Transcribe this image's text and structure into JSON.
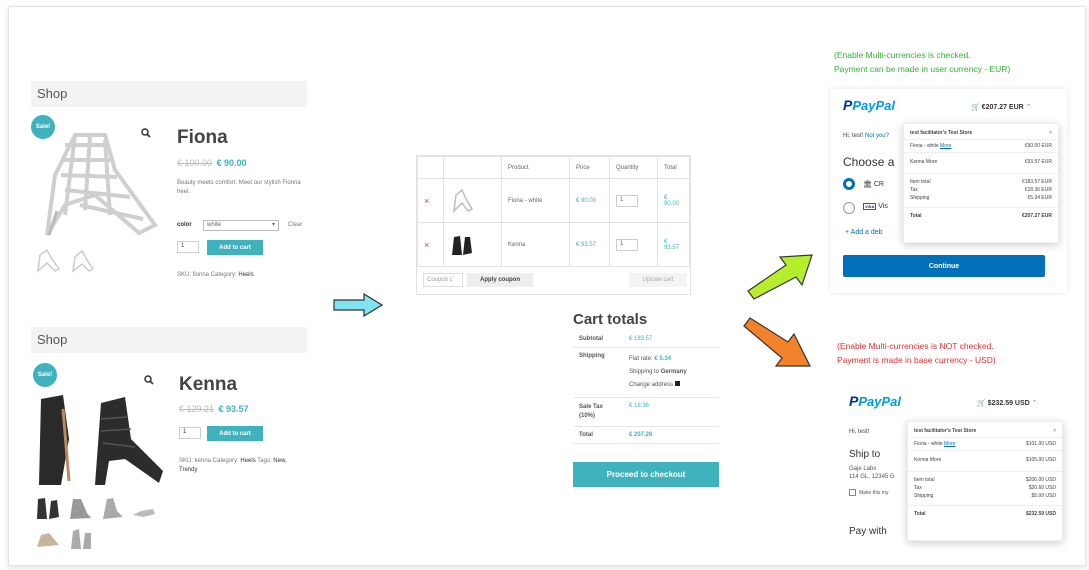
{
  "shop1": {
    "heading": "Shop",
    "sale_badge": "Sale!",
    "title": "Fiona",
    "old_price": "€ 100.00",
    "price": "€ 90.00",
    "description": "Beauty meets comfort. Meet our stylish Fionna heel.",
    "color_label": "color",
    "color_value": "white",
    "clear_label": "Clear",
    "qty": "1",
    "add_to_cart": "Add to cart",
    "sku_text": "SKU: fionna Category:",
    "category": "Heels"
  },
  "shop2": {
    "heading": "Shop",
    "sale_badge": "Sale!",
    "title": "Kenna",
    "old_price": "€ 129.21",
    "price": "€ 93.57",
    "qty": "1",
    "add_to_cart": "Add to cart",
    "sku_text": "SKU: kenna Category:",
    "category": "Heels",
    "tags_label": "Tags:",
    "tags": "New, Trendy"
  },
  "cart": {
    "headers": [
      "",
      "",
      "Product",
      "Price",
      "Quantity",
      "Total"
    ],
    "rows": [
      {
        "remove": "×",
        "product": "Fiona - white",
        "price": "€ 90.00",
        "qty": "1",
        "total": "€ 90.00"
      },
      {
        "remove": "×",
        "product": "Kenna",
        "price": "€ 93.57",
        "qty": "1",
        "total": "€ 93.57"
      }
    ],
    "coupon_placeholder": "Coupon c",
    "apply_coupon": "Apply coupon",
    "update_cart": "Update cart"
  },
  "totals": {
    "title": "Cart totals",
    "subtotal_label": "Subtotal",
    "subtotal_value": "€ 183.57",
    "shipping_label": "Shipping",
    "flat_rate": "Flat rate:",
    "flat_rate_value": "€ 5.34",
    "shipping_to": "Shipping to",
    "country": "Germany",
    "change_address": "Change address",
    "tax_label": "Sale Tax (10%)",
    "tax_value": "€ 18.36",
    "total_label": "Total",
    "total_value": "€ 207.26",
    "checkout": "Proceed to checkout"
  },
  "note_eur": {
    "line1": "(Enable Multi-currencies is checked.",
    "line2": "Payment can be made in user currency - EUR)",
    "color": "#33b233"
  },
  "note_usd": {
    "line1": "(Enable Multi-currencies is NOT checked.",
    "line2": "Payment is made in base currency - USD)",
    "color": "#e03030"
  },
  "paypal_eur": {
    "logo": "PayPal",
    "cart_amount": "€207.27 EUR",
    "greeting": "Hi, test!",
    "not_you": "Not you?",
    "choose": "Choose a",
    "opt1": "CR",
    "opt2": "Vis",
    "opt2_badge": "VISA",
    "add": "Add a deb",
    "continue": "Continue",
    "popup": {
      "store": "test facilitator's Test Store",
      "item1": "Fiona - white",
      "item1_more": "More",
      "item1_price": "€90.00 EUR",
      "item2": "Kenna More",
      "item2_price": "€93.57 EUR",
      "item_total": "Item total",
      "item_total_value": "€183.57 EUR",
      "tax": "Tax",
      "tax_value": "€18.36 EUR",
      "shipping": "Shipping",
      "shipping_value": "€5.34 EUR",
      "total": "Total",
      "total_value": "€207.27 EUR"
    }
  },
  "paypal_usd": {
    "logo": "PayPal",
    "cart_amount": "$232.59 USD",
    "greeting": "Hi, test!",
    "ship_to": "Ship to",
    "name": "Gaje Labs",
    "address": "114 GL, 12345 G",
    "make_this": "Make this my",
    "pay_with": "Pay with",
    "popup": {
      "store": "test facilitator's Test Store",
      "item1": "Fiona - white",
      "item1_more": "More",
      "item1_price": "$101.00 USD",
      "item2": "Kenna More",
      "item2_price": "$105.00 USD",
      "item_total": "Item total",
      "item_total_value": "$206.00 USD",
      "tax": "Tax",
      "tax_value": "$20.60 USD",
      "shipping": "Shipping",
      "shipping_value": "$5.99 USD",
      "total": "Total",
      "total_value": "$232.59 USD"
    }
  },
  "colors": {
    "teal": "#3fb2be",
    "paypal_blue": "#003087",
    "paypal_light": "#009cde",
    "continue": "#0070ba",
    "arrow_cyan": "#7fe4f0",
    "arrow_green": "#b6ee2b",
    "arrow_orange": "#f2832a"
  },
  "icons": [
    "magnifier-icon",
    "cart-icon",
    "bank-icon",
    "visa-icon",
    "plus-icon",
    "close-icon",
    "chevron-up-icon",
    "remove-icon",
    "arrow-right-icon",
    "arrow-up-right-icon",
    "arrow-down-right-icon"
  ]
}
